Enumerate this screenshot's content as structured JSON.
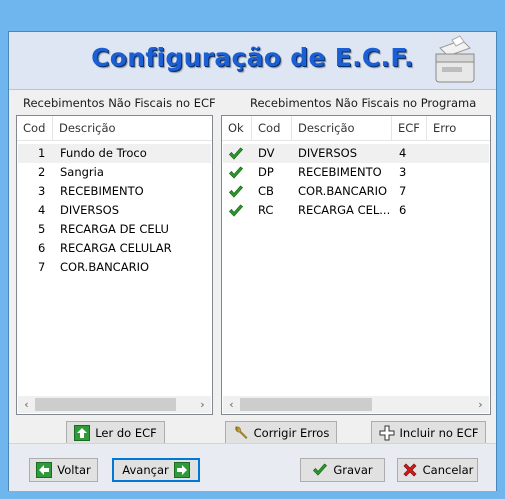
{
  "header": {
    "title": "Configuração de E.C.F.",
    "printer_icon": "receipt-printer-icon"
  },
  "left_panel": {
    "label": "Recebimentos Não Fiscais no ECF",
    "columns": [
      "Cod",
      "Descrição"
    ],
    "rows": [
      {
        "cod": "1",
        "descricao": "Fundo de Troco"
      },
      {
        "cod": "2",
        "descricao": "Sangria"
      },
      {
        "cod": "3",
        "descricao": "RECEBIMENTO"
      },
      {
        "cod": "4",
        "descricao": "DIVERSOS"
      },
      {
        "cod": "5",
        "descricao": "RECARGA DE CELU"
      },
      {
        "cod": "6",
        "descricao": "RECARGA CELULAR"
      },
      {
        "cod": "7",
        "descricao": "COR.BANCARIO"
      }
    ],
    "button": "Ler do ECF"
  },
  "right_panel": {
    "label": "Recebimentos Não Fiscais no Programa",
    "columns": [
      "Ok",
      "Cod",
      "Descrição",
      "ECF",
      "Erro"
    ],
    "rows": [
      {
        "ok": "check-icon",
        "cod": "DV",
        "descricao": "DIVERSOS",
        "ecf": "4",
        "erro": ""
      },
      {
        "ok": "check-icon",
        "cod": "DP",
        "descricao": "RECEBIMENTO",
        "ecf": "3",
        "erro": ""
      },
      {
        "ok": "check-icon",
        "cod": "CB",
        "descricao": "COR.BANCARIO",
        "ecf": "7",
        "erro": ""
      },
      {
        "ok": "check-icon",
        "cod": "RC",
        "descricao": "RECARGA CEL...",
        "ecf": "6",
        "erro": ""
      }
    ],
    "buttons": {
      "fix": "Corrigir Erros",
      "add": "Incluir no ECF"
    }
  },
  "footer": {
    "back": "Voltar",
    "next": "Avançar",
    "save": "Gravar",
    "cancel": "Cancelar"
  },
  "colors": {
    "title": "#1a5fd3",
    "frame": "#6fb6ef",
    "check": "#2e9b2e",
    "cancel": "#d11a1a"
  }
}
